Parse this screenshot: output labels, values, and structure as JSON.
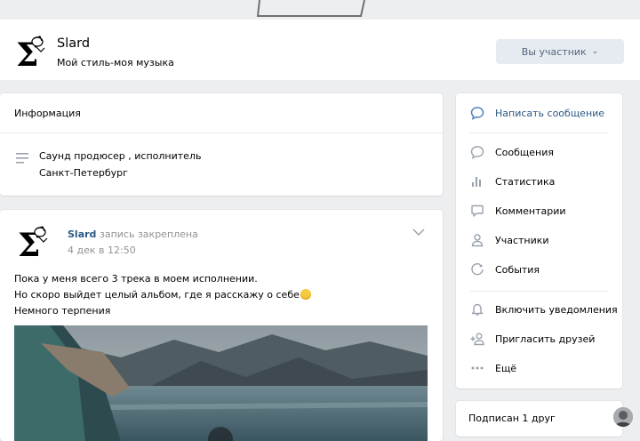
{
  "group": {
    "name": "Slard",
    "status": "Мой стиль-моя музыка",
    "member_button": "Вы участник"
  },
  "info": {
    "title": "Информация",
    "lines": [
      "Саунд продюсер , исполнитель",
      "Санкт-Петербург"
    ]
  },
  "post": {
    "author": "Slard",
    "pinned": "запись закреплена",
    "date": "4 дек в 12:50",
    "lines": [
      "Пока у меня всего 3 трека в моем исполнении.",
      "Но скоро выйдет целый альбом, где я расскажу о себе",
      "Немного терпения"
    ]
  },
  "sidebar": {
    "items": [
      {
        "label": "Написать сообщение",
        "icon": "message-bubble-icon"
      },
      {
        "label": "Сообщения",
        "icon": "chat-icon"
      },
      {
        "label": "Статистика",
        "icon": "stats-icon"
      },
      {
        "label": "Комментарии",
        "icon": "comment-icon"
      },
      {
        "label": "Участники",
        "icon": "user-icon"
      },
      {
        "label": "События",
        "icon": "calendar-icon"
      },
      {
        "label": "Включить уведомления",
        "icon": "bell-icon"
      },
      {
        "label": "Пригласить друзей",
        "icon": "add-user-icon"
      },
      {
        "label": "Ещё",
        "icon": "more-icon"
      }
    ]
  },
  "friends": {
    "label": "Подписан 1 друг"
  },
  "colors": {
    "link": "#2a5885",
    "accent": "#5181b8",
    "icon": "#99a2ad",
    "background": "#edeef0"
  }
}
